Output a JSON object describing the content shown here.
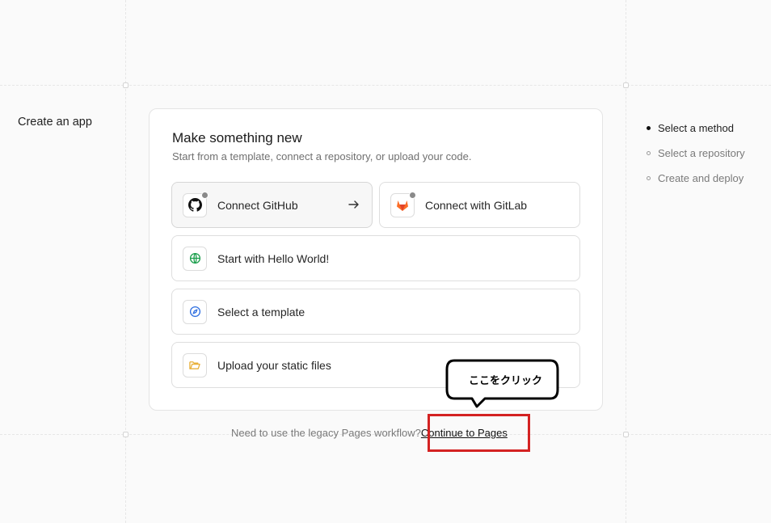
{
  "page": {
    "heading": "Create an app"
  },
  "card": {
    "title": "Make something new",
    "subtitle": "Start from a template, connect a repository, or upload your code.",
    "options": [
      {
        "label": "Connect GitHub",
        "icon": "github-icon"
      },
      {
        "label": "Connect with GitLab",
        "icon": "gitlab-icon"
      },
      {
        "label": "Start with Hello World!",
        "icon": "globe-icon"
      },
      {
        "label": "Select a template",
        "icon": "compass-icon"
      },
      {
        "label": "Upload your static files",
        "icon": "folder-icon"
      }
    ]
  },
  "legacy": {
    "text": "Need to use the legacy Pages workflow?",
    "link": "Continue to Pages"
  },
  "annotation": {
    "bubble_text": "ここをクリック",
    "highlight_color": "#d42222"
  },
  "steps": [
    {
      "label": "Select a method",
      "active": true
    },
    {
      "label": "Select a repository",
      "active": false
    },
    {
      "label": "Create and deploy",
      "active": false
    }
  ],
  "colors": {
    "gitlab_orange": "#e24329",
    "globe_green": "#1a9e4b",
    "compass_blue": "#2f6fe0",
    "folder_yellow": "#e8b13a"
  }
}
